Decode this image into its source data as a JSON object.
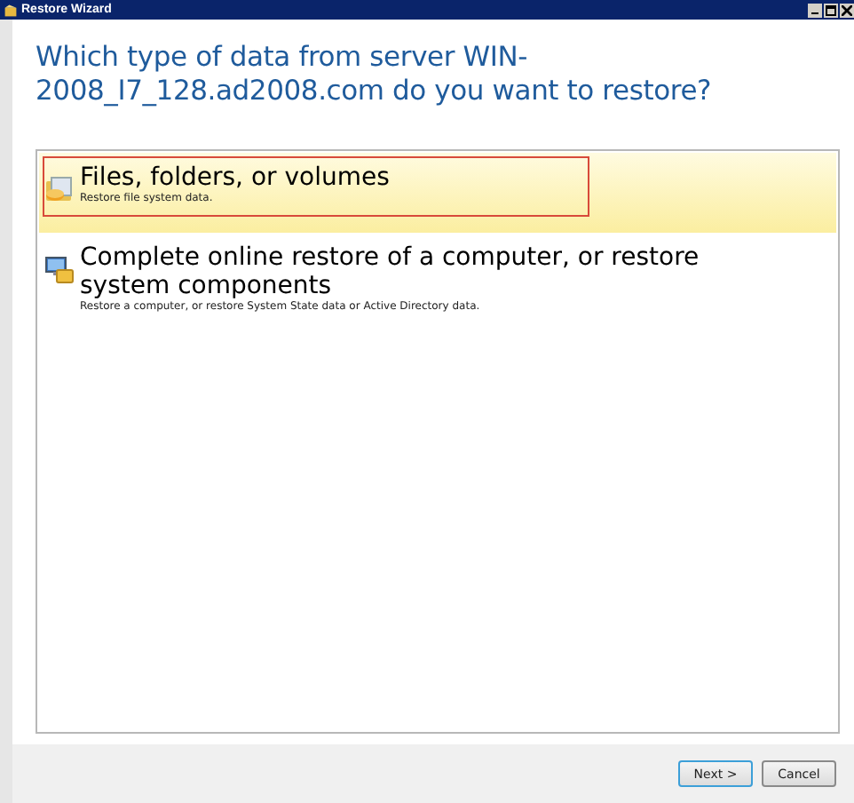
{
  "window": {
    "title": "Restore Wizard"
  },
  "heading": "Which type of data from server WIN-2008_I7_128.ad2008.com do you want to restore?",
  "options": [
    {
      "kind": "files",
      "title": "Files, folders, or volumes",
      "description": "Restore file system data.",
      "selected": true
    },
    {
      "kind": "system",
      "title": "Complete online restore of a computer, or restore system components",
      "description": "Restore a computer, or restore System State data or Active Directory data.",
      "selected": false
    }
  ],
  "buttons": [
    "Next >",
    "Cancel"
  ]
}
